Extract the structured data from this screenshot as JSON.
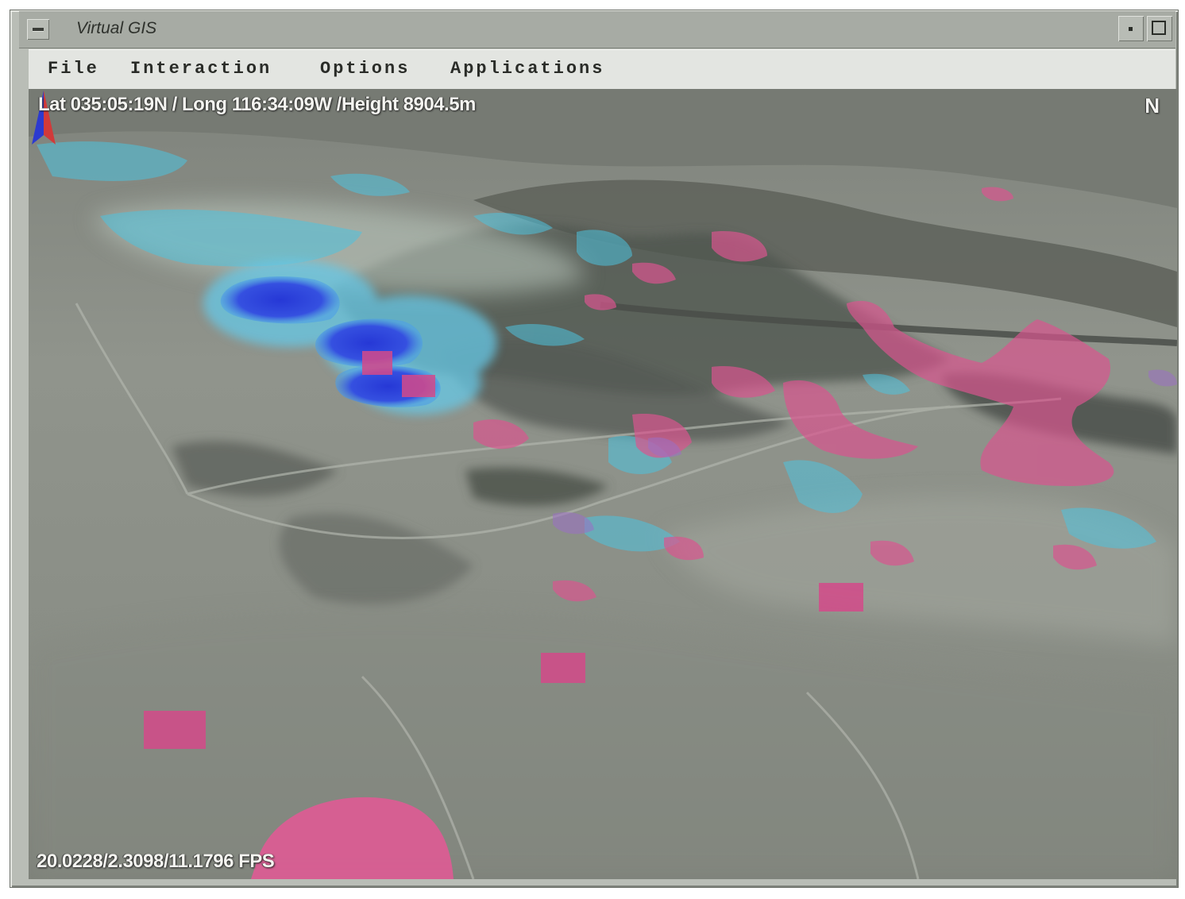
{
  "window": {
    "title": "Virtual GIS"
  },
  "menu": {
    "items": [
      {
        "label": "File"
      },
      {
        "label": "Interaction"
      },
      {
        "label": "Options"
      },
      {
        "label": "Applications"
      }
    ]
  },
  "viewport": {
    "coordinate_readout": "Lat 035:05:19N / Long 116:34:09W /Height 8904.5m",
    "fps_readout": "20.0228/2.3098/11.1796 FPS",
    "north_label": "N",
    "compass_icon": "north-arrow-icon"
  },
  "colors": {
    "terrain": "#8d918a",
    "overlay_pink": "#d9558f",
    "overlay_cyan": "#4ec3df",
    "overlay_blue": "#2a3fd8"
  }
}
